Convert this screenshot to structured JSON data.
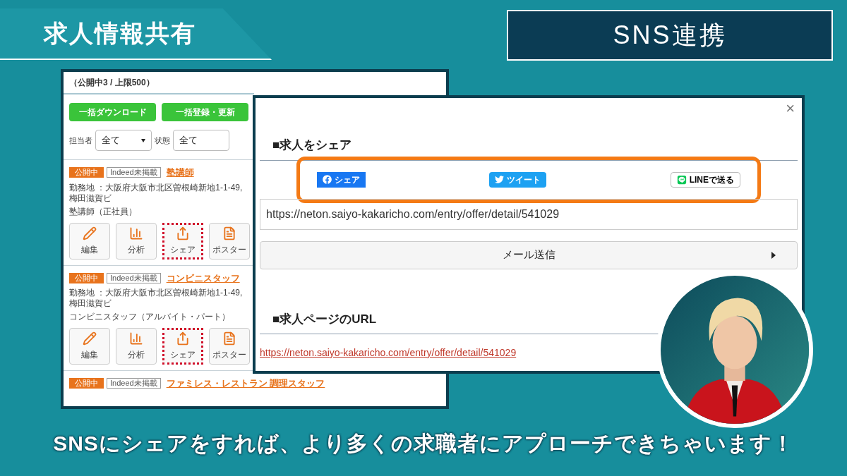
{
  "headline": "求人情報共有",
  "section_badge": "SNS連携",
  "job_list": {
    "summary": "（公開中3 / 上限500）",
    "bulk_buttons": [
      "一括ダウンロード",
      "一括登録・更新"
    ],
    "filters": [
      {
        "label": "担当者",
        "value": "全て",
        "dropdown": true
      },
      {
        "label": "状態",
        "value": "全て",
        "dropdown": false
      }
    ],
    "jobs": [
      {
        "status": "公開中",
        "tag": "Indeed未掲載",
        "title": "塾講師",
        "location": "勤務地 ：大阪府大阪市北区曽根崎新地1-1-49, 梅田滋賀ビ",
        "detail": "塾講師（正社員）",
        "actions": [
          {
            "kind": "edit",
            "label": "編集",
            "highlighted": false
          },
          {
            "kind": "analytics",
            "label": "分析",
            "highlighted": false
          },
          {
            "kind": "share",
            "label": "シェア",
            "highlighted": true
          },
          {
            "kind": "poster",
            "label": "ポスター",
            "highlighted": false
          }
        ]
      },
      {
        "status": "公開中",
        "tag": "Indeed未掲載",
        "title": "コンビニスタッフ",
        "location": "勤務地 ：大阪府大阪市北区曽根崎新地1-1-49, 梅田滋賀ビ",
        "detail": "コンビニスタッフ（アルバイト・パート）",
        "actions": [
          {
            "kind": "edit",
            "label": "編集",
            "highlighted": false
          },
          {
            "kind": "analytics",
            "label": "分析",
            "highlighted": false
          },
          {
            "kind": "share",
            "label": "シェア",
            "highlighted": true
          },
          {
            "kind": "poster",
            "label": "ポスター",
            "highlighted": false
          }
        ]
      },
      {
        "status": "公開中",
        "tag": "Indeed未掲載",
        "title": "ファミレス・レストラン 調理スタッフ"
      }
    ]
  },
  "share_modal": {
    "close": "×",
    "share_heading": "■求人をシェア",
    "share_buttons": [
      {
        "kind": "facebook",
        "label": "シェア"
      },
      {
        "kind": "twitter",
        "label": "ツイート"
      },
      {
        "kind": "line",
        "label": "LINEで送る"
      }
    ],
    "url_field": "https://neton.saiyo-kakaricho.com/entry/offer/detail/541029",
    "mail_button": "メール送信",
    "page_url_heading": "■求人ページのURL",
    "page_url_link": "https://neton.saiyo-kakaricho.com/entry/offer/detail/541029"
  },
  "caption": "SNSにシェアをすれば、より多くの求職者にアプローチできちゃいます！"
}
